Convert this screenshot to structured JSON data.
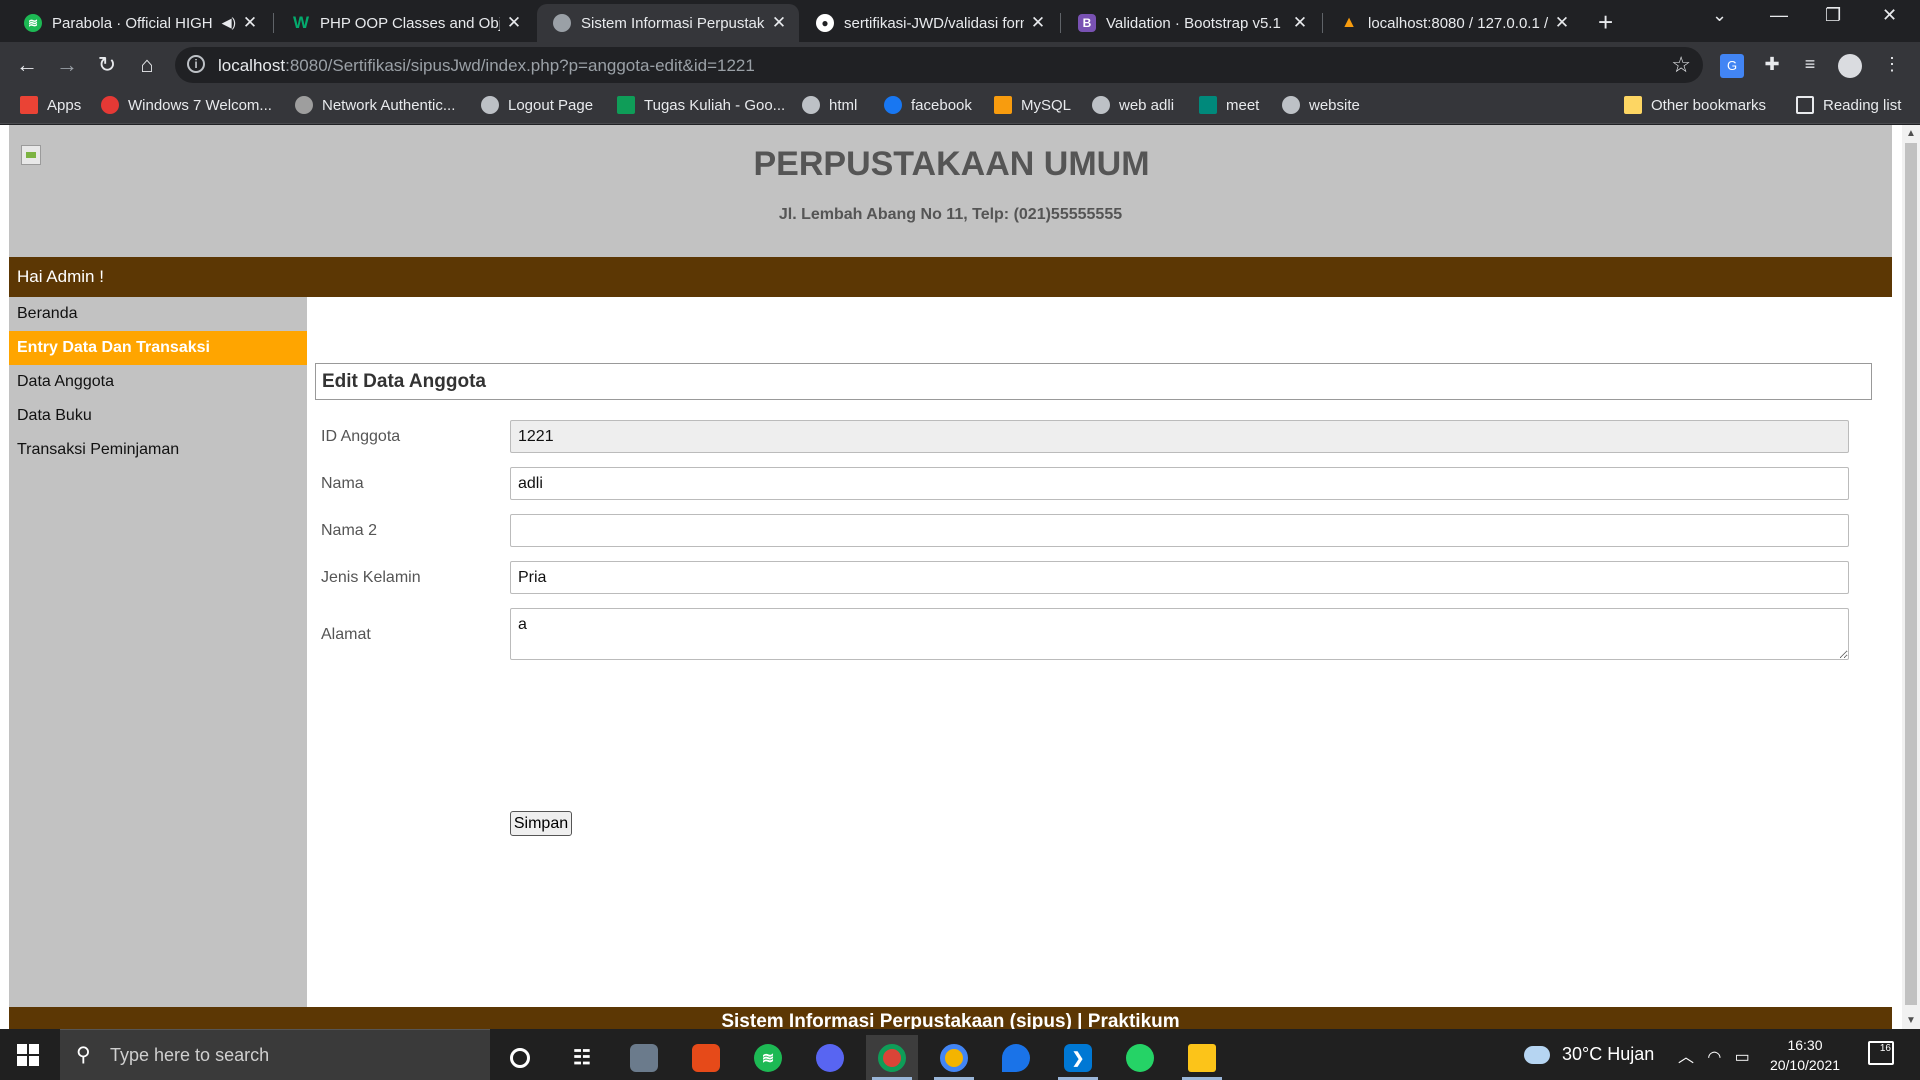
{
  "browser": {
    "tabs": [
      {
        "title": "Parabola · Official HIGH",
        "favicon": "spotify-icon",
        "color": "#1db954"
      },
      {
        "title": "PHP OOP Classes and Objec",
        "favicon": "w3schools-icon",
        "color": "#04aa6d"
      },
      {
        "title": "Sistem Informasi Perpustaka",
        "favicon": "globe-icon",
        "color": "#9aa0a6"
      },
      {
        "title": "sertifikasi-JWD/validasi form",
        "favicon": "github-icon",
        "color": "#ffffff"
      },
      {
        "title": "Validation · Bootstrap v5.1",
        "favicon": "bootstrap-icon",
        "color": "#7952b3"
      },
      {
        "title": "localhost:8080 / 127.0.0.1 /",
        "favicon": "phpmyadmin-icon",
        "color": "#f89c0e"
      }
    ],
    "url_host": "localhost",
    "url_rest": ":8080/Sertifikasi/sipusJwd/index.php?p=anggota-edit&id=1221",
    "bookmarks": [
      {
        "label": "Apps",
        "color": "#ea4335"
      },
      {
        "label": "Windows 7 Welcom...",
        "color": "#e53935"
      },
      {
        "label": "Network Authentic...",
        "color": "#9e9e9e"
      },
      {
        "label": "Logout Page",
        "color": "#bdc1c6"
      },
      {
        "label": "Tugas Kuliah - Goo...",
        "color": "#0f9d58"
      },
      {
        "label": "html",
        "color": "#bdc1c6"
      },
      {
        "label": "facebook",
        "color": "#1877f2"
      },
      {
        "label": "MySQL",
        "color": "#f89c0e"
      },
      {
        "label": "web adli",
        "color": "#bdc1c6"
      },
      {
        "label": "meet",
        "color": "#00897b"
      },
      {
        "label": "website",
        "color": "#bdc1c6"
      }
    ],
    "other_bookmarks": "Other bookmarks",
    "reading_list": "Reading list"
  },
  "page": {
    "site_title": "PERPUSTAKAAN UMUM",
    "site_address": "Jl. Lembah Abang No 11, Telp: (021)55555555",
    "greeting": "Hai Admin !",
    "menu": [
      {
        "label": "Beranda",
        "active": false
      },
      {
        "label": "Entry Data Dan Transaksi",
        "active": true
      },
      {
        "label": "Data Anggota",
        "active": false
      },
      {
        "label": "Data Buku",
        "active": false
      },
      {
        "label": "Transaksi Peminjaman",
        "active": false
      }
    ],
    "panel_title": "Edit Data Anggota",
    "form": {
      "id_label": "ID Anggota",
      "id_value": "1221",
      "nama_label": "Nama",
      "nama_value": "adli",
      "nama2_label": "Nama 2",
      "nama2_value": "",
      "jk_label": "Jenis Kelamin",
      "jk_value": "Pria",
      "alamat_label": "Alamat",
      "alamat_value": "a",
      "submit_label": "Simpan"
    },
    "footer": "Sistem Informasi Perpustakaan (sipus) | Praktikum",
    "colors": {
      "header_bg": "#c2c2c2",
      "bar_brown": "#5c3704",
      "menu_active": "#ffa500"
    }
  },
  "taskbar": {
    "search_placeholder": "Type here to search",
    "weather": "30°C  Hujan",
    "time": "16:30",
    "date": "20/10/2021",
    "notifications": "16",
    "apps": [
      "cortana-icon",
      "task-view-icon",
      "photos-icon",
      "office-icon",
      "spotify-icon",
      "discord-icon",
      "chrome-icon",
      "chrome-profile-icon",
      "maps-icon",
      "vscode-icon",
      "whatsapp-icon",
      "file-explorer-icon"
    ]
  }
}
